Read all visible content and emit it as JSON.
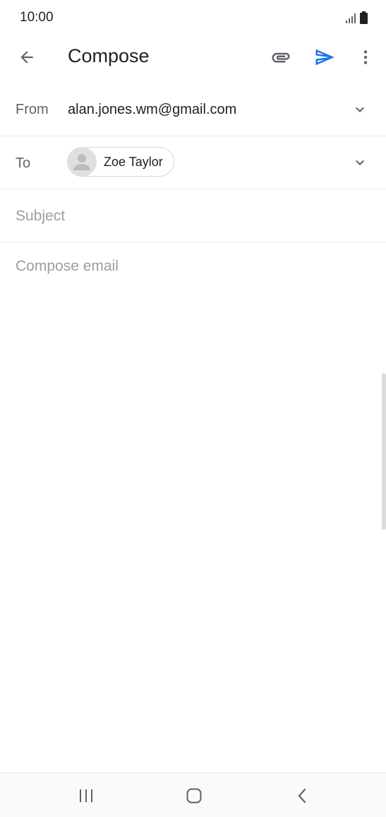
{
  "status_bar": {
    "time": "10:00"
  },
  "app_bar": {
    "title": "Compose",
    "icons": {
      "back": "arrow-left-icon",
      "attach": "paperclip-icon",
      "send": "send-icon",
      "more": "more-vert-icon"
    }
  },
  "from": {
    "label": "From",
    "value": "alan.jones.wm@gmail.com"
  },
  "to": {
    "label": "To",
    "recipients": [
      {
        "name": "Zoe Taylor"
      }
    ]
  },
  "subject": {
    "placeholder": "Subject",
    "value": ""
  },
  "body": {
    "placeholder": "Compose email",
    "value": ""
  },
  "colors": {
    "accent": "#1a73e8",
    "text_primary": "#202124",
    "text_secondary": "#5f6368",
    "placeholder": "#9e9e9e"
  },
  "nav_bar": {
    "icons": [
      "recents-icon",
      "home-icon",
      "back-icon"
    ]
  }
}
